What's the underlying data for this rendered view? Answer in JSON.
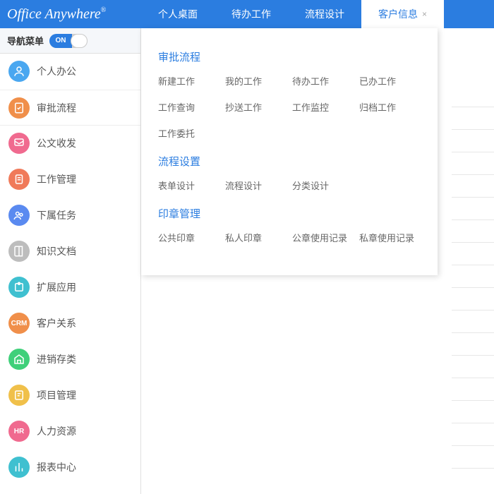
{
  "topbar": {
    "logo_text": "Office Anywhere",
    "logo_sup": "®",
    "tabs": [
      {
        "label": "个人桌面",
        "closable": false,
        "active": false
      },
      {
        "label": "待办工作",
        "closable": false,
        "active": false
      },
      {
        "label": "流程设计",
        "closable": false,
        "active": false
      },
      {
        "label": "客户信息",
        "closable": true,
        "active": true
      }
    ]
  },
  "sidebar": {
    "header_label": "导航菜单",
    "toggle_text": "ON",
    "items": [
      {
        "label": "个人办公",
        "icon": "user",
        "color": "#4aa7f0",
        "active": false
      },
      {
        "label": "审批流程",
        "icon": "approve",
        "color": "#f08f4a",
        "active": true
      },
      {
        "label": "公文收发",
        "icon": "doc-send",
        "color": "#f06a8f",
        "active": false
      },
      {
        "label": "工作管理",
        "icon": "clipboard",
        "color": "#f07a5a",
        "active": false
      },
      {
        "label": "下属任务",
        "icon": "group",
        "color": "#5a8af0",
        "active": false
      },
      {
        "label": "知识文档",
        "icon": "book",
        "color": "#bdbdbd",
        "active": false
      },
      {
        "label": "扩展应用",
        "icon": "puzzle",
        "color": "#3fc0d0",
        "active": false
      },
      {
        "label": "客户关系",
        "icon": "crm",
        "color": "#f08f4a",
        "active": false,
        "badge": "CRM"
      },
      {
        "label": "进销存类",
        "icon": "stock",
        "color": "#3fd07a",
        "active": false
      },
      {
        "label": "项目管理",
        "icon": "project",
        "color": "#f0c04a",
        "active": false
      },
      {
        "label": "人力资源",
        "icon": "hr",
        "color": "#f06a8f",
        "active": false,
        "badge": "HR"
      },
      {
        "label": "报表中心",
        "icon": "chart",
        "color": "#3fc0d0",
        "active": false
      }
    ]
  },
  "flyout": {
    "sections": [
      {
        "title": "审批流程",
        "links": [
          "新建工作",
          "我的工作",
          "待办工作",
          "已办工作",
          "工作查询",
          "抄送工作",
          "工作监控",
          "归档工作",
          "工作委托"
        ]
      },
      {
        "title": "流程设置",
        "links": [
          "表单设计",
          "流程设计",
          "分类设计"
        ]
      },
      {
        "title": "印章管理",
        "links": [
          "公共印章",
          "私人印章",
          "公章使用记录",
          "私章使用记录"
        ]
      }
    ]
  },
  "close_symbol": "×"
}
